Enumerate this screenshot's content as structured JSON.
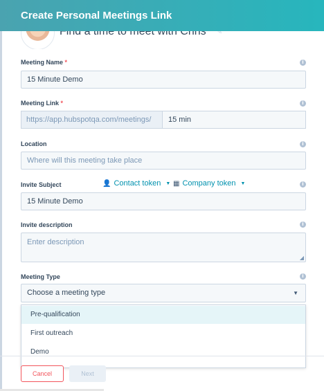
{
  "modal": {
    "title": "Create Personal Meetings Link"
  },
  "subhead": {
    "text": "Find a time to meet with Chris"
  },
  "meeting_name": {
    "label": "Meeting Name",
    "required": "*",
    "value": "15 Minute Demo"
  },
  "meeting_link": {
    "label": "Meeting Link",
    "required": "*",
    "url": "https://app.hubspotqa.com/meetings/",
    "duration": "15 min"
  },
  "location": {
    "label": "Location",
    "placeholder": "Where will this meeting take place"
  },
  "invite_subject": {
    "label": "Invite Subject",
    "contact_token": "Contact token",
    "company_token": "Company token",
    "value": "15 Minute Demo"
  },
  "invite_description": {
    "label": "Invite description",
    "placeholder": "Enter description"
  },
  "meeting_type": {
    "label": "Meeting Type",
    "selected": "Choose a meeting type",
    "options": [
      "Pre-qualification",
      "First outreach",
      "Demo"
    ]
  },
  "footer": {
    "cancel": "Cancel",
    "next": "Next"
  },
  "icons": {
    "info": "info-icon",
    "pencil": "pencil-icon",
    "contact": "person-icon",
    "company": "building-icon",
    "caret": "caret-down-icon"
  },
  "colors": {
    "header": "#27b6bd",
    "required": "#f2545b",
    "link": "#0091ae",
    "cancel": "#f2545b",
    "highlight": "#e5f5f8"
  }
}
